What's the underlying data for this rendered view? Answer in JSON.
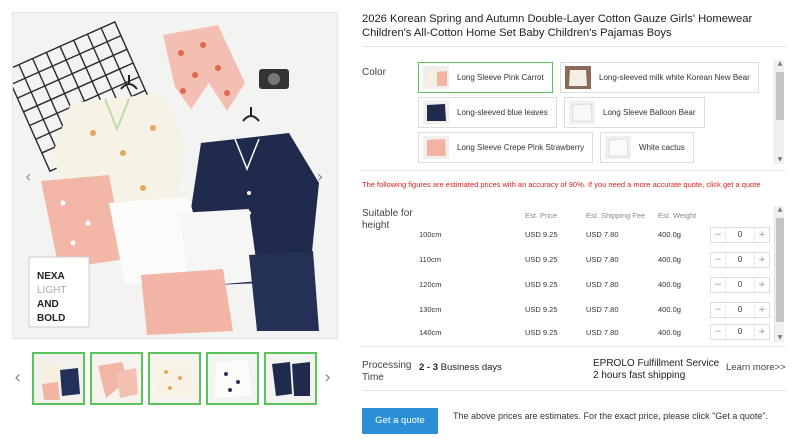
{
  "product": {
    "title": "2026 Korean Spring and Autumn Double-Layer Cotton Gauze Girls' Homewear Children's All-Cotton Home Set Baby Children's Pajamas Boys"
  },
  "gallery": {
    "prev_icon": "chevron-left-icon",
    "next_icon": "chevron-right-icon",
    "thumbs_prev": "‹",
    "thumbs_next": "›",
    "prev_glyph": "‹",
    "next_glyph": "›",
    "thumbnail_count": 5
  },
  "color": {
    "label": "Color",
    "options": [
      {
        "label": "Long Sleeve Pink Carrot",
        "selected": true
      },
      {
        "label": "Long-sleeved milk white Korean New Bear",
        "selected": false
      },
      {
        "label": "Long-sleeved blue leaves",
        "selected": false
      },
      {
        "label": "Long Sleeve Balloon Bear",
        "selected": false
      },
      {
        "label": "Long Sleeve Crepe Pink Strawberry",
        "selected": false
      },
      {
        "label": "White cactus",
        "selected": false
      }
    ]
  },
  "notice": "The following figures are estimated prices with an accuracy of 90%. If you need a more accurate quote, click get a quote",
  "sizes": {
    "label": "Suitable for height",
    "columns": {
      "price": "Est. Price",
      "shipping": "Est. Shipping Fee",
      "weight": "Est. Weight"
    },
    "rows": [
      {
        "height": "100cm",
        "price": "USD 9.25",
        "shipping": "USD 7.80",
        "weight": "400.0g",
        "qty": "0"
      },
      {
        "height": "110cm",
        "price": "USD 9.25",
        "shipping": "USD 7.80",
        "weight": "400.0g",
        "qty": "0"
      },
      {
        "height": "120cm",
        "price": "USD 9.25",
        "shipping": "USD 7.80",
        "weight": "400.0g",
        "qty": "0"
      },
      {
        "height": "130cm",
        "price": "USD 9.25",
        "shipping": "USD 7.80",
        "weight": "400.0g",
        "qty": "0"
      },
      {
        "height": "140cm",
        "price": "USD 9.25",
        "shipping": "USD 7.80",
        "weight": "400.0g",
        "qty": "0"
      }
    ],
    "minus": "−",
    "plus": "+"
  },
  "processing": {
    "label": "Processing Time",
    "range": "2 - 3",
    "unit": " Business days",
    "service_name": "EPROLO Fulfillment Service",
    "service_desc": "2 hours fast shipping",
    "learn_more": "Learn more>>"
  },
  "footer": {
    "button": "Get a quote",
    "note": "The above prices are estimates. For the exact price, please click \"Get a quote\"."
  },
  "colors": {
    "accent": "#2b8fd6",
    "selected_border": "#5cc25c",
    "warning": "#e02020"
  }
}
